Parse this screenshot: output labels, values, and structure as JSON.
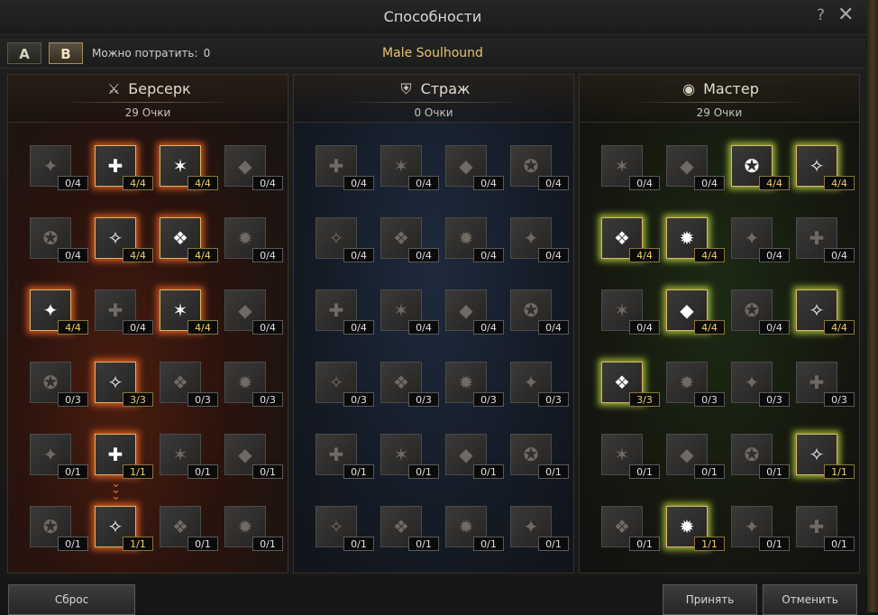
{
  "window": {
    "title": "Способности",
    "help": "?",
    "close": "✕"
  },
  "toolbar": {
    "preset_a": "A",
    "preset_b": "B",
    "spend_label": "Можно потратить:",
    "spend_value": "0",
    "class_name": "Male Soulhound"
  },
  "trees": [
    {
      "name": "Берсерк",
      "icon": "crossed-swords-icon",
      "points": "29 Очки",
      "skills": [
        [
          "0/4",
          "4/4",
          "4/4",
          "0/4"
        ],
        [
          "0/4",
          "4/4",
          "4/4",
          "0/4"
        ],
        [
          "4/4",
          "0/4",
          "4/4",
          "0/4"
        ],
        [
          "0/3",
          "3/3",
          "0/3",
          "0/3"
        ],
        [
          "0/1",
          "1/1",
          "0/1",
          "0/1"
        ],
        [
          "0/1",
          "1/1",
          "0/1",
          "0/1"
        ]
      ]
    },
    {
      "name": "Страж",
      "icon": "shield-icon",
      "points": "0 Очки",
      "skills": [
        [
          "0/4",
          "0/4",
          "0/4",
          "0/4"
        ],
        [
          "0/4",
          "0/4",
          "0/4",
          "0/4"
        ],
        [
          "0/4",
          "0/4",
          "0/4",
          "0/4"
        ],
        [
          "0/3",
          "0/3",
          "0/3",
          "0/3"
        ],
        [
          "0/1",
          "0/1",
          "0/1",
          "0/1"
        ],
        [
          "0/1",
          "0/1",
          "0/1",
          "0/1"
        ]
      ]
    },
    {
      "name": "Мастер",
      "icon": "eye-icon",
      "points": "29 Очки",
      "skills": [
        [
          "0/4",
          "0/4",
          "4/4",
          "4/4"
        ],
        [
          "4/4",
          "4/4",
          "0/4",
          "0/4"
        ],
        [
          "0/4",
          "4/4",
          "0/4",
          "4/4"
        ],
        [
          "3/3",
          "0/3",
          "0/3",
          "0/3"
        ],
        [
          "0/1",
          "0/1",
          "0/1",
          "1/1"
        ],
        [
          "0/1",
          "1/1",
          "0/1",
          "0/1"
        ]
      ]
    }
  ],
  "buttons": {
    "reset": "Сброс",
    "accept": "Принять",
    "cancel": "Отменить"
  },
  "colors": {
    "accent": "#e8c46a",
    "berserker_glow": "#ff6e28",
    "master_glow": "#c8e646"
  }
}
